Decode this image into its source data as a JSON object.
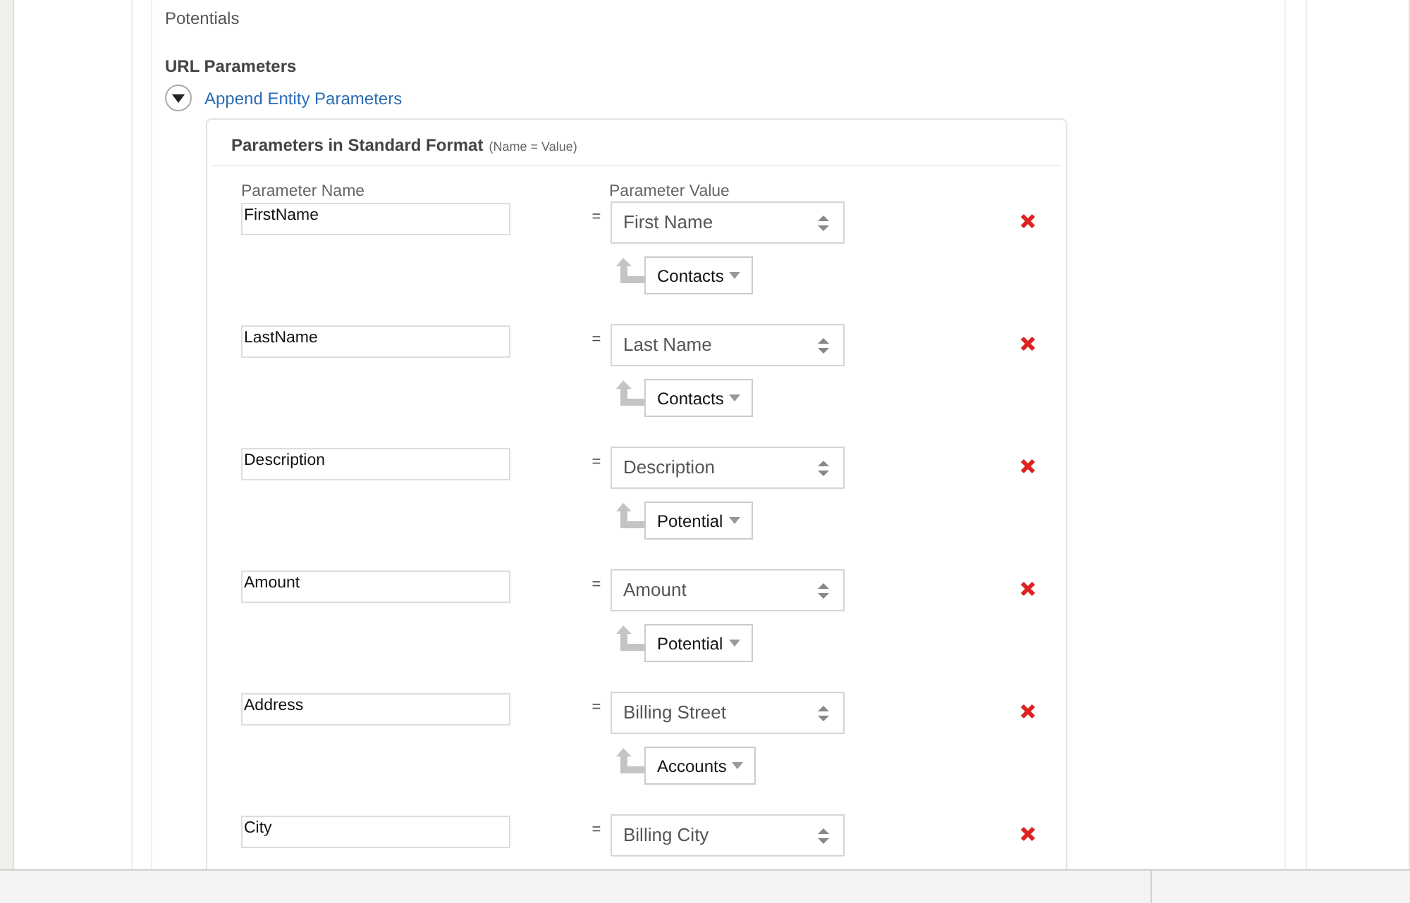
{
  "module": {
    "value": "Potentials"
  },
  "url_parameters": {
    "heading": "URL Parameters",
    "toggle_label": "Append Entity Parameters",
    "expanded": true
  },
  "card": {
    "title": "Parameters in Standard Format",
    "subtitle": "(Name = Value)",
    "name_column": "Parameter Name",
    "value_column": "Parameter Value",
    "equals": "="
  },
  "rows": [
    {
      "name": "FirstName",
      "value": "First Name",
      "entity": "Contacts"
    },
    {
      "name": "LastName",
      "value": "Last Name",
      "entity": "Contacts"
    },
    {
      "name": "Description",
      "value": "Description",
      "entity": "Potential"
    },
    {
      "name": "Amount",
      "value": "Amount",
      "entity": "Potential"
    },
    {
      "name": "Address",
      "value": "Billing Street",
      "entity": "Accounts"
    },
    {
      "name": "City",
      "value": "Billing City"
    }
  ]
}
